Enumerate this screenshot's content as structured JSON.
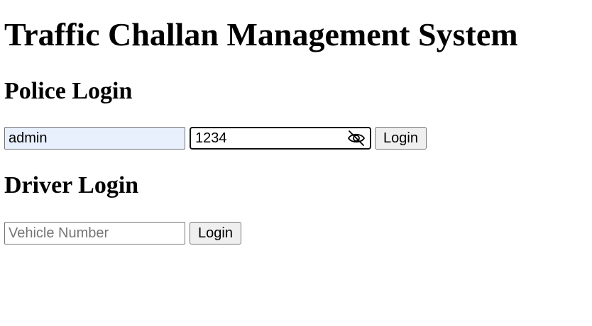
{
  "page": {
    "title": "Traffic Challan Management System"
  },
  "police_login": {
    "heading": "Police Login",
    "username_value": "admin",
    "password_value": "1234",
    "password_toggle_icon": "eye-slash-icon",
    "button_label": "Login"
  },
  "driver_login": {
    "heading": "Driver Login",
    "vehicle_placeholder": "Vehicle Number",
    "vehicle_value": "",
    "button_label": "Login"
  },
  "colors": {
    "autofill_background": "#e8f0fe",
    "button_background": "#efefef",
    "placeholder_text": "#757575"
  }
}
